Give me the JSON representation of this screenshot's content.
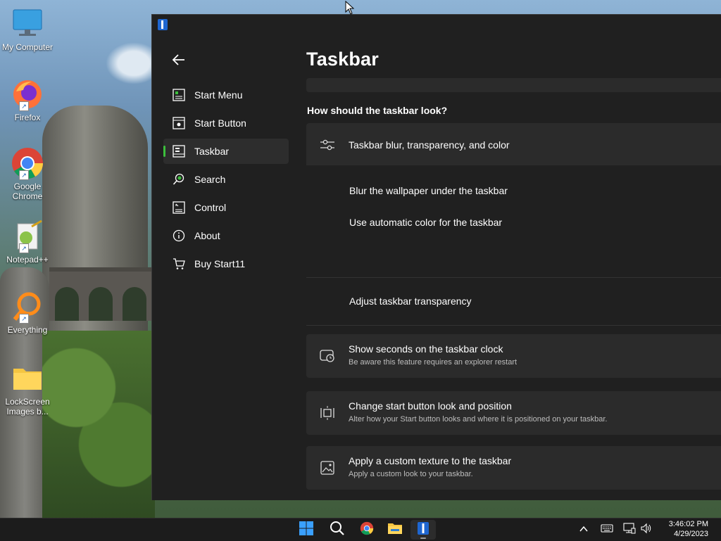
{
  "desktop": {
    "icons": [
      {
        "label": "My Computer"
      },
      {
        "label": "Firefox"
      },
      {
        "label": "Google Chrome"
      },
      {
        "label": "Notepad++"
      },
      {
        "label": "Everything"
      },
      {
        "label": "LockScreen Images b..."
      }
    ]
  },
  "window": {
    "nav": [
      {
        "label": "Start Menu",
        "icon": "start-menu-icon"
      },
      {
        "label": "Start Button",
        "icon": "start-button-icon"
      },
      {
        "label": "Taskbar",
        "icon": "taskbar-icon",
        "active": true
      },
      {
        "label": "Search",
        "icon": "search-icon"
      },
      {
        "label": "Control",
        "icon": "control-icon"
      },
      {
        "label": "About",
        "icon": "info-icon"
      },
      {
        "label": "Buy Start11",
        "icon": "cart-icon"
      }
    ],
    "page_title": "Taskbar",
    "section_heading": "How should the taskbar look?",
    "blur_card": {
      "title": "Taskbar blur, transparency, and color",
      "icon": "sliders-icon",
      "options": [
        "Blur the wallpaper under the taskbar",
        "Use automatic color for the taskbar"
      ]
    },
    "transparency_card": {
      "title": "Adjust taskbar transparency"
    },
    "seconds_card": {
      "title": "Show seconds on the taskbar clock",
      "subtitle": "Be aware this feature requires an explorer restart",
      "icon": "clock-icon"
    },
    "start_button_card": {
      "title": "Change start button look and position",
      "subtitle": "Alter how your Start button looks and where it is positioned on your taskbar.",
      "icon": "position-icon"
    },
    "texture_card": {
      "title": "Apply a custom texture to the taskbar",
      "subtitle": "Apply a custom look to your taskbar.",
      "icon": "image-icon"
    }
  },
  "taskbar": {
    "apps": [
      "windows-start-icon",
      "search-icon",
      "chrome-icon",
      "file-explorer-icon",
      "start11-icon"
    ],
    "clock_time": "3:46:02 PM",
    "clock_date": "4/29/2023",
    "tray": [
      "chevron-up-icon",
      "keyboard-icon",
      "network-icon",
      "volume-icon"
    ]
  },
  "colors": {
    "accent": "#3cbf3c",
    "window_bg": "#202020",
    "card_bg": "#2b2b2b"
  }
}
